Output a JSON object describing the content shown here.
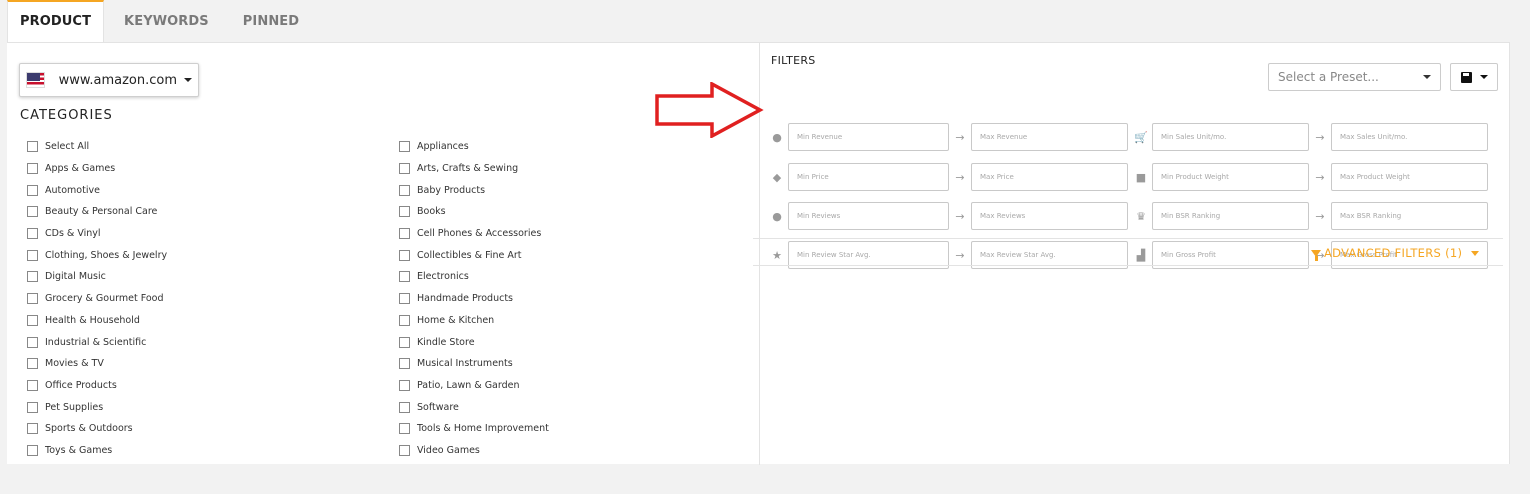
{
  "tabs": [
    {
      "label": "PRODUCT",
      "active": true
    },
    {
      "label": "KEYWORDS",
      "active": false
    },
    {
      "label": "PINNED",
      "active": false
    }
  ],
  "marketplace": {
    "label": "www.amazon.com",
    "flag": "us-flag-icon"
  },
  "categories": {
    "title": "CATEGORIES",
    "column1": [
      "Select All",
      "Apps & Games",
      "Automotive",
      "Beauty & Personal Care",
      "CDs & Vinyl",
      "Clothing, Shoes & Jewelry",
      "Digital Music",
      "Grocery & Gourmet Food",
      "Health & Household",
      "Industrial & Scientific",
      "Movies & TV",
      "Office Products",
      "Pet Supplies",
      "Sports & Outdoors",
      "Toys & Games"
    ],
    "column2": [
      "Appliances",
      "Arts, Crafts & Sewing",
      "Baby Products",
      "Books",
      "Cell Phones & Accessories",
      "Collectibles & Fine Art",
      "Electronics",
      "Handmade Products",
      "Home & Kitchen",
      "Kindle Store",
      "Musical Instruments",
      "Patio, Lawn & Garden",
      "Software",
      "Tools & Home Improvement",
      "Video Games"
    ]
  },
  "preset": {
    "placeholder": "Select a Preset..."
  },
  "filters": {
    "title": "FILTERS",
    "rows": [
      {
        "left_icon": "dollar-icon",
        "left_min": "Min Revenue",
        "left_max": "Max Revenue",
        "right_icon": "cart-icon",
        "right_min": "Min Sales Unit/mo.",
        "right_max": "Max Sales Unit/mo."
      },
      {
        "left_icon": "price-tag-icon",
        "left_min": "Min Price",
        "left_max": "Max Price",
        "right_icon": "weight-icon",
        "right_min": "Min Product Weight",
        "right_max": "Max Product Weight"
      },
      {
        "left_icon": "comments-icon",
        "left_min": "Min Reviews",
        "left_max": "Max Reviews",
        "right_icon": "trophy-icon",
        "right_min": "Min BSR Ranking",
        "right_max": "Max BSR Ranking"
      },
      {
        "left_icon": "star-icon",
        "left_min": "Min Review Star Avg.",
        "left_max": "Max Review Star Avg.",
        "right_icon": "bar-chart-icon",
        "right_min": "Min Gross Profit",
        "right_max": "Max Gross Profit"
      }
    ]
  },
  "advanced_filters": {
    "label": "ADVANCED FILTERS (1)"
  },
  "colors": {
    "accent": "#f5a623",
    "annotation_arrow": "#e02020"
  }
}
